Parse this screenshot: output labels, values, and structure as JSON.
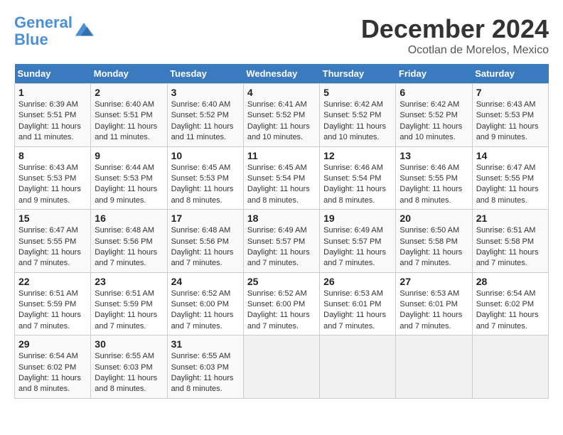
{
  "header": {
    "logo_line1": "General",
    "logo_line2": "Blue",
    "month": "December 2024",
    "location": "Ocotlan de Morelos, Mexico"
  },
  "days_of_week": [
    "Sunday",
    "Monday",
    "Tuesday",
    "Wednesday",
    "Thursday",
    "Friday",
    "Saturday"
  ],
  "weeks": [
    [
      {
        "day": "1",
        "sunrise": "6:39 AM",
        "sunset": "5:51 PM",
        "daylight": "11 hours and 11 minutes."
      },
      {
        "day": "2",
        "sunrise": "6:40 AM",
        "sunset": "5:51 PM",
        "daylight": "11 hours and 11 minutes."
      },
      {
        "day": "3",
        "sunrise": "6:40 AM",
        "sunset": "5:52 PM",
        "daylight": "11 hours and 11 minutes."
      },
      {
        "day": "4",
        "sunrise": "6:41 AM",
        "sunset": "5:52 PM",
        "daylight": "11 hours and 10 minutes."
      },
      {
        "day": "5",
        "sunrise": "6:42 AM",
        "sunset": "5:52 PM",
        "daylight": "11 hours and 10 minutes."
      },
      {
        "day": "6",
        "sunrise": "6:42 AM",
        "sunset": "5:52 PM",
        "daylight": "11 hours and 10 minutes."
      },
      {
        "day": "7",
        "sunrise": "6:43 AM",
        "sunset": "5:53 PM",
        "daylight": "11 hours and 9 minutes."
      }
    ],
    [
      {
        "day": "8",
        "sunrise": "6:43 AM",
        "sunset": "5:53 PM",
        "daylight": "11 hours and 9 minutes."
      },
      {
        "day": "9",
        "sunrise": "6:44 AM",
        "sunset": "5:53 PM",
        "daylight": "11 hours and 9 minutes."
      },
      {
        "day": "10",
        "sunrise": "6:45 AM",
        "sunset": "5:53 PM",
        "daylight": "11 hours and 8 minutes."
      },
      {
        "day": "11",
        "sunrise": "6:45 AM",
        "sunset": "5:54 PM",
        "daylight": "11 hours and 8 minutes."
      },
      {
        "day": "12",
        "sunrise": "6:46 AM",
        "sunset": "5:54 PM",
        "daylight": "11 hours and 8 minutes."
      },
      {
        "day": "13",
        "sunrise": "6:46 AM",
        "sunset": "5:55 PM",
        "daylight": "11 hours and 8 minutes."
      },
      {
        "day": "14",
        "sunrise": "6:47 AM",
        "sunset": "5:55 PM",
        "daylight": "11 hours and 8 minutes."
      }
    ],
    [
      {
        "day": "15",
        "sunrise": "6:47 AM",
        "sunset": "5:55 PM",
        "daylight": "11 hours and 7 minutes."
      },
      {
        "day": "16",
        "sunrise": "6:48 AM",
        "sunset": "5:56 PM",
        "daylight": "11 hours and 7 minutes."
      },
      {
        "day": "17",
        "sunrise": "6:48 AM",
        "sunset": "5:56 PM",
        "daylight": "11 hours and 7 minutes."
      },
      {
        "day": "18",
        "sunrise": "6:49 AM",
        "sunset": "5:57 PM",
        "daylight": "11 hours and 7 minutes."
      },
      {
        "day": "19",
        "sunrise": "6:49 AM",
        "sunset": "5:57 PM",
        "daylight": "11 hours and 7 minutes."
      },
      {
        "day": "20",
        "sunrise": "6:50 AM",
        "sunset": "5:58 PM",
        "daylight": "11 hours and 7 minutes."
      },
      {
        "day": "21",
        "sunrise": "6:51 AM",
        "sunset": "5:58 PM",
        "daylight": "11 hours and 7 minutes."
      }
    ],
    [
      {
        "day": "22",
        "sunrise": "6:51 AM",
        "sunset": "5:59 PM",
        "daylight": "11 hours and 7 minutes."
      },
      {
        "day": "23",
        "sunrise": "6:51 AM",
        "sunset": "5:59 PM",
        "daylight": "11 hours and 7 minutes."
      },
      {
        "day": "24",
        "sunrise": "6:52 AM",
        "sunset": "6:00 PM",
        "daylight": "11 hours and 7 minutes."
      },
      {
        "day": "25",
        "sunrise": "6:52 AM",
        "sunset": "6:00 PM",
        "daylight": "11 hours and 7 minutes."
      },
      {
        "day": "26",
        "sunrise": "6:53 AM",
        "sunset": "6:01 PM",
        "daylight": "11 hours and 7 minutes."
      },
      {
        "day": "27",
        "sunrise": "6:53 AM",
        "sunset": "6:01 PM",
        "daylight": "11 hours and 7 minutes."
      },
      {
        "day": "28",
        "sunrise": "6:54 AM",
        "sunset": "6:02 PM",
        "daylight": "11 hours and 7 minutes."
      }
    ],
    [
      {
        "day": "29",
        "sunrise": "6:54 AM",
        "sunset": "6:02 PM",
        "daylight": "11 hours and 8 minutes."
      },
      {
        "day": "30",
        "sunrise": "6:55 AM",
        "sunset": "6:03 PM",
        "daylight": "11 hours and 8 minutes."
      },
      {
        "day": "31",
        "sunrise": "6:55 AM",
        "sunset": "6:03 PM",
        "daylight": "11 hours and 8 minutes."
      },
      null,
      null,
      null,
      null
    ]
  ],
  "labels": {
    "sunrise": "Sunrise: ",
    "sunset": "Sunset: ",
    "daylight": "Daylight: "
  }
}
